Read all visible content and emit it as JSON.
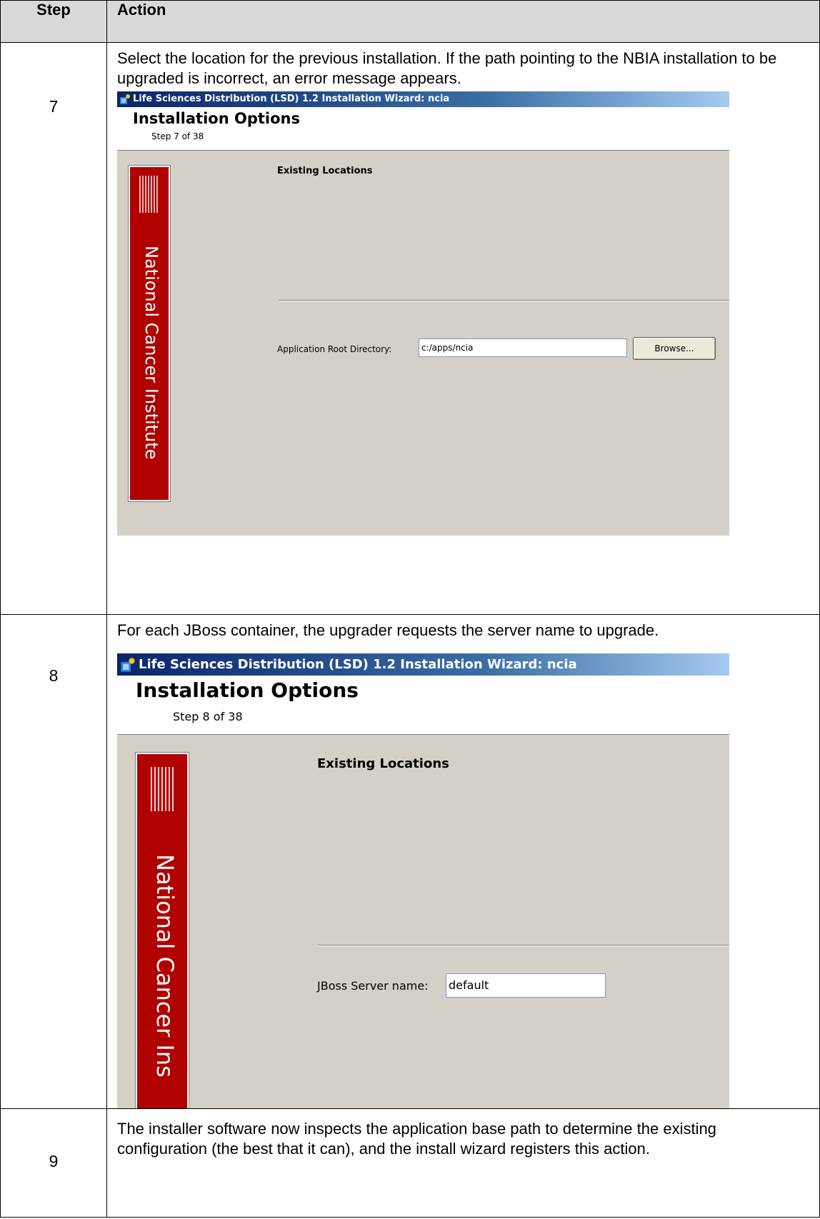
{
  "table": {
    "header_step": "Step",
    "header_action": "Action"
  },
  "rows": [
    {
      "step": "7",
      "description": "Select the location for the previous installation.  If the path pointing to the NBIA installation to be upgraded is incorrect, an error message appears.",
      "wizard": {
        "title": "Life Sciences Distribution (LSD) 1.2 Installation Wizard: ncia",
        "header_title": "Installation Options",
        "header_step": "Step 7 of 38",
        "logo_text": "NATIONAL CANCER INSTITUTE",
        "vertical_text": "National Cancer Institute",
        "section_title": "Existing Locations",
        "field_label": "Application Root Directory:",
        "field_value": "c:/apps/ncia",
        "button_label": "Browse..."
      }
    },
    {
      "step": "8",
      "description": "For each JBoss container, the upgrader requests the server name to upgrade.",
      "wizard": {
        "title": "Life Sciences Distribution (LSD) 1.2 Installation Wizard: ncia",
        "header_title": "Installation Options",
        "header_step": "Step 8 of 38",
        "logo_text": "NATIONAL CANCER INSTITUTE",
        "vertical_text": "National Cancer Ins",
        "section_title": "Existing Locations",
        "field_label": "JBoss Server name:",
        "field_value": "default"
      }
    },
    {
      "step": "9",
      "description": "The installer software now inspects the application base path to determine the existing configuration (the best that it can), and the install wizard registers this action."
    }
  ],
  "colors": {
    "header_fill": "#d9d9d9",
    "wizard_bg": "#d4d0c8",
    "nci_red": "#b00000",
    "titlebar": "#0a246a"
  },
  "icons": [
    "installer-app-icon"
  ]
}
